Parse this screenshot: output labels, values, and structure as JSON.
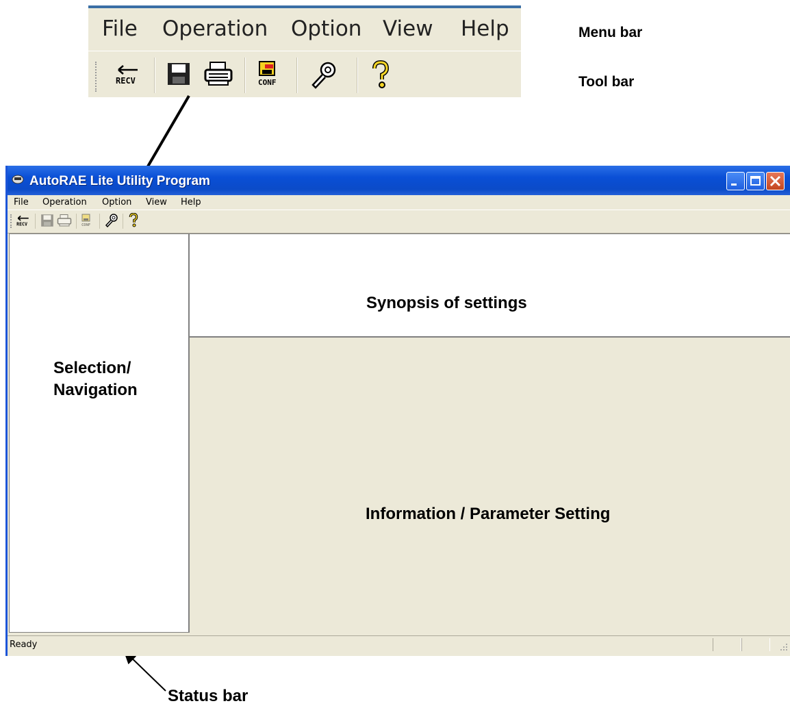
{
  "zoom": {
    "menu": [
      "File",
      "Operation",
      "Option",
      "View",
      "Help"
    ],
    "toolbar_icons": [
      "recv-icon",
      "save-icon",
      "print-icon",
      "config-icon",
      "wrench-icon",
      "help-icon"
    ]
  },
  "annotations": {
    "menu_bar": "Menu bar",
    "tool_bar": "Tool bar",
    "status_bar": "Status bar"
  },
  "window": {
    "title": "AutoRAE Lite Utility Program",
    "menu": [
      "File",
      "Operation",
      "Option",
      "View",
      "Help"
    ],
    "toolbar_icons": [
      "recv-icon",
      "save-icon",
      "print-icon",
      "config-icon",
      "wrench-icon",
      "help-icon"
    ],
    "left_pane_label": [
      "Selection/",
      "Navigation"
    ],
    "synopsis_label": "Synopsis of settings",
    "info_label": "Information / Parameter Setting",
    "status_text": "Ready"
  },
  "colors": {
    "title_bar": "#0b4bc8",
    "window_face": "#ece9d8",
    "close_button": "#c3461f"
  }
}
